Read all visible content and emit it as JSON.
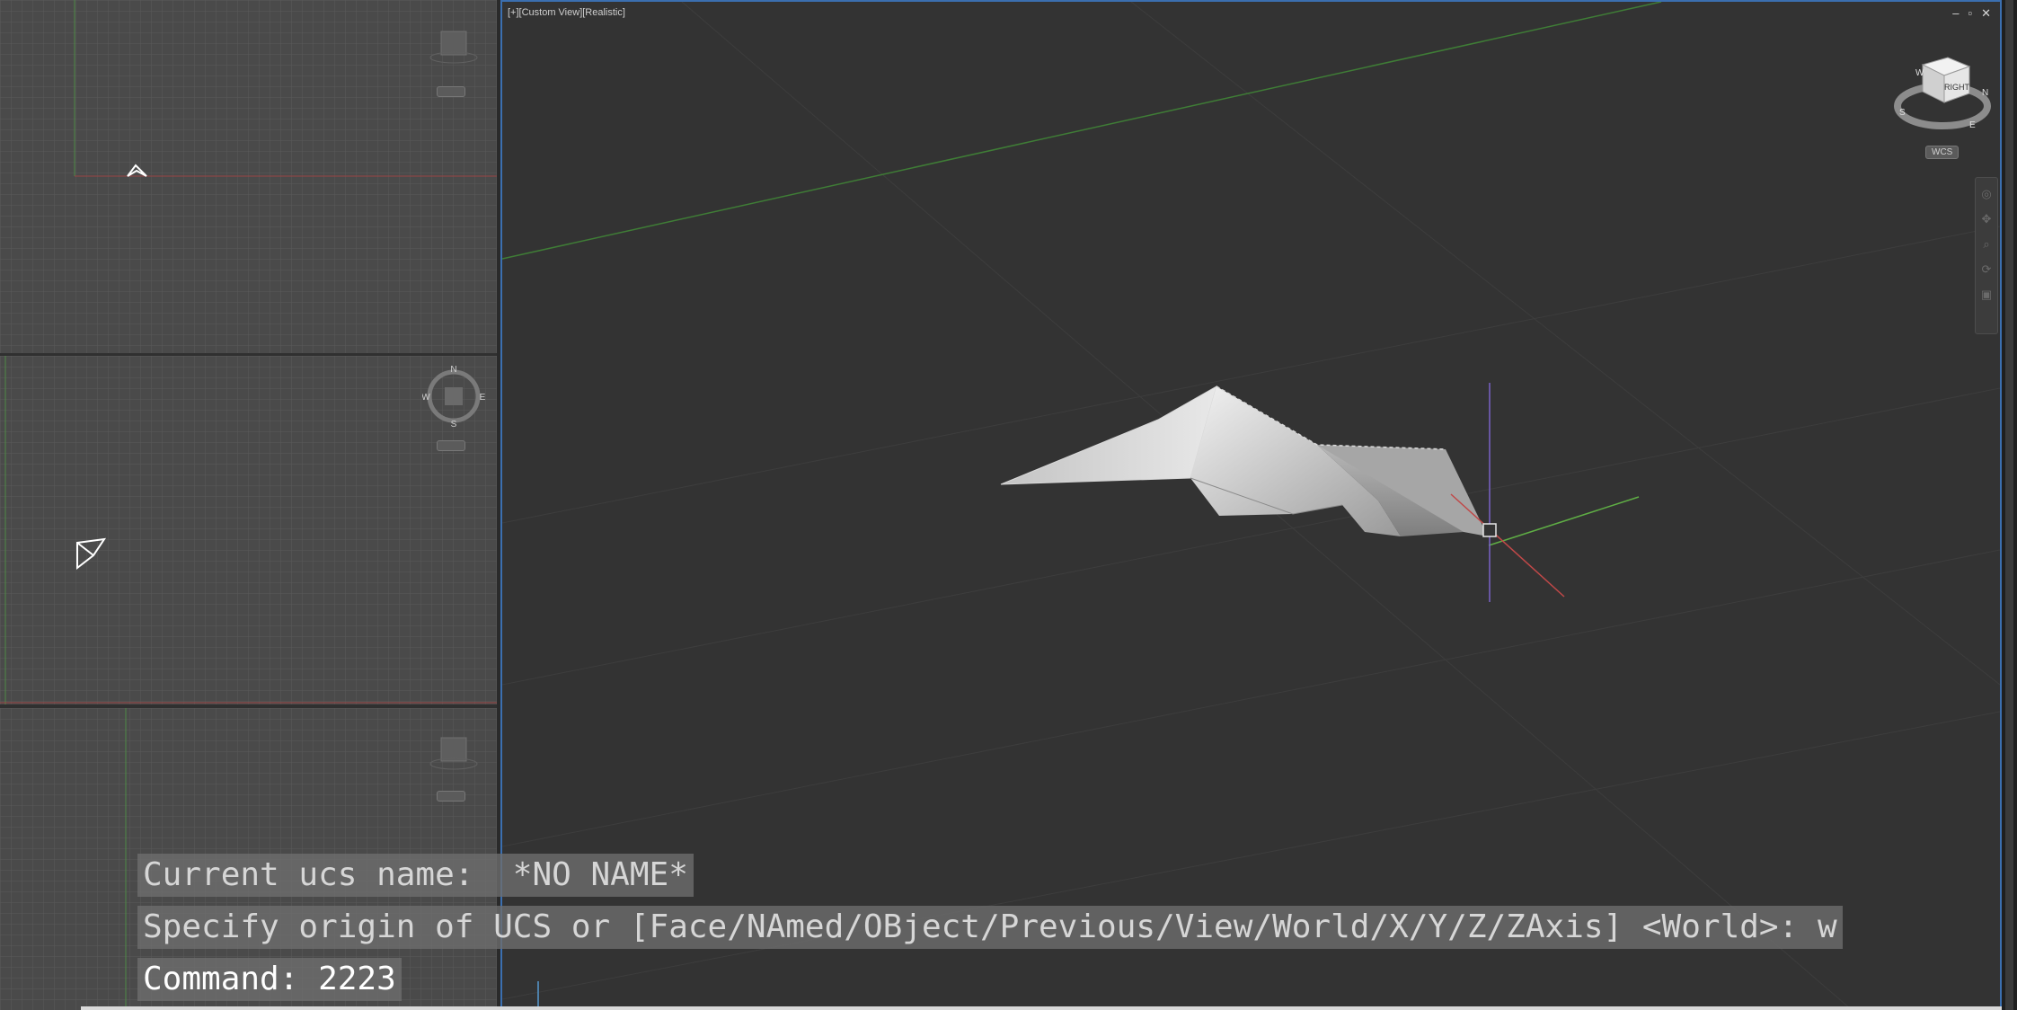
{
  "main_viewport": {
    "label": "[+][Custom View][Realistic]",
    "window_controls": [
      "–",
      "▫",
      "✕"
    ],
    "wcs_label": "WCS",
    "viewcube_face": "RIGHT",
    "compass": {
      "n": "N",
      "s": "S",
      "e": "E",
      "w": "W"
    }
  },
  "left_viewports": {
    "mid_compass": {
      "n": "N",
      "s": "S",
      "e": "E",
      "w": "W"
    }
  },
  "command_line": {
    "history": [
      "Current ucs name:  *NO NAME*",
      "Specify origin of UCS or [Face/NAmed/OBject/Previous/View/World/X/Y/Z/ZAxis] <World>: w"
    ],
    "prompt": "Command: 2223"
  },
  "colors": {
    "viewport_bg": "#333333",
    "active_border": "#3b6fb0",
    "x_axis": "#c04848",
    "y_axis": "#5fae45",
    "z_axis": "#7a62c8"
  }
}
